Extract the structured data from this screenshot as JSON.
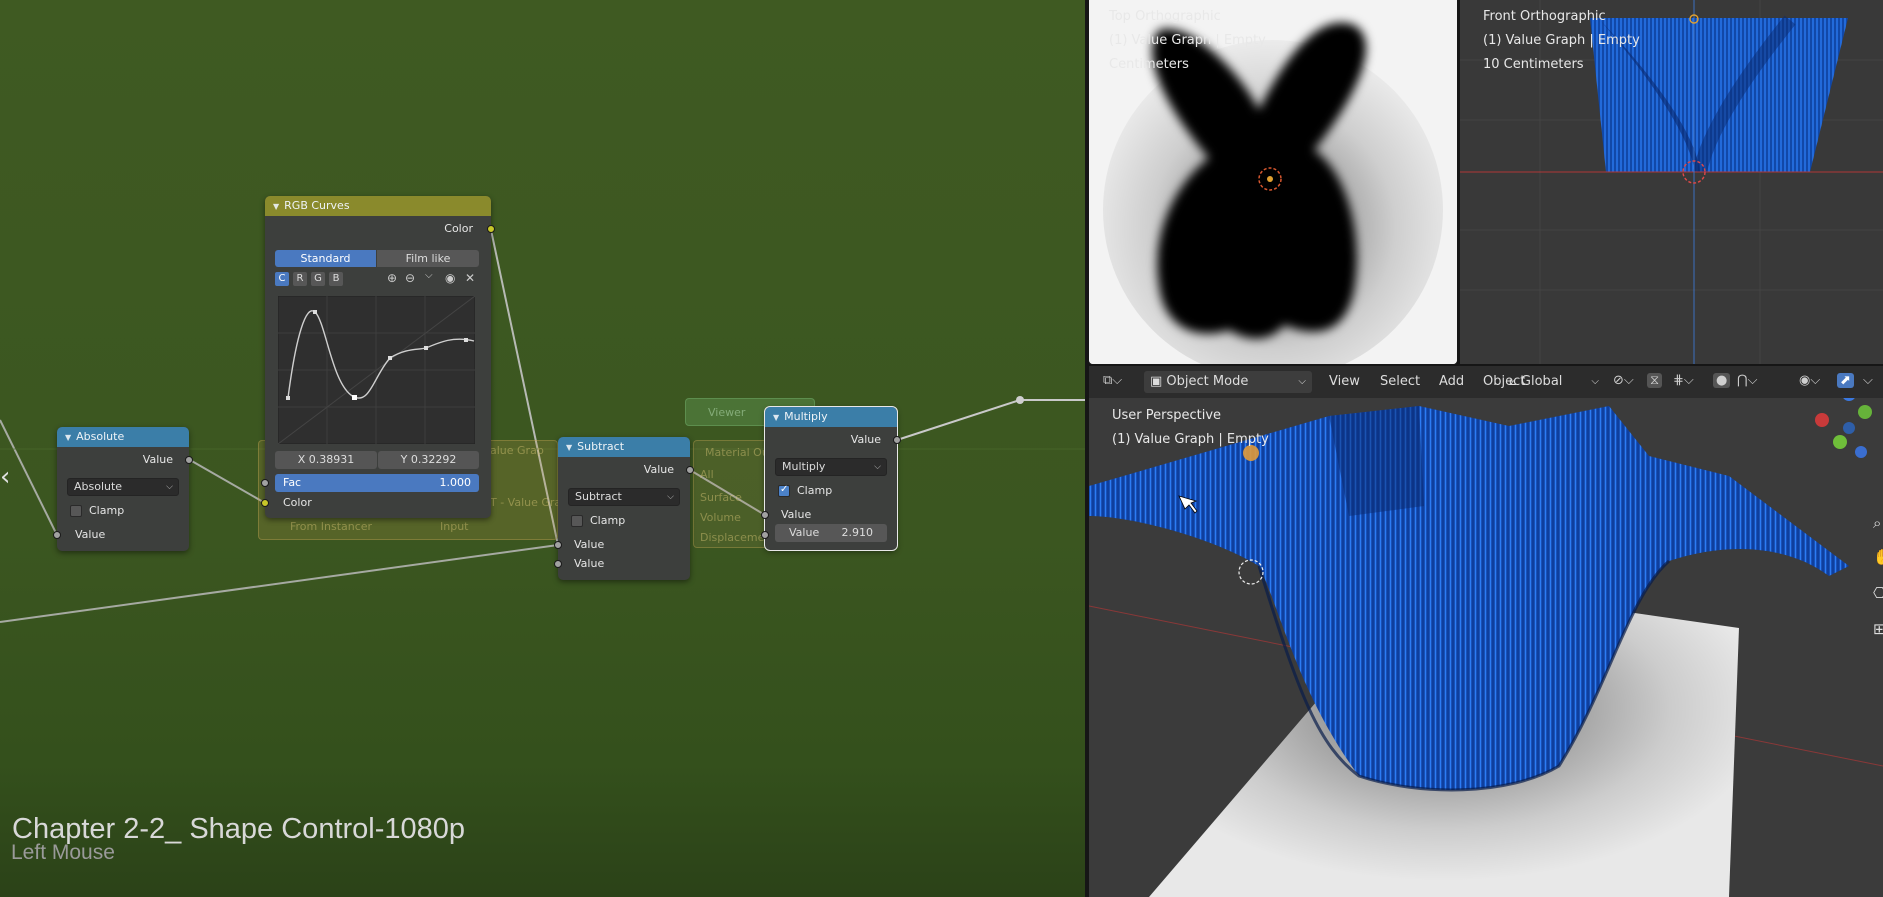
{
  "node_editor": {
    "nodes": {
      "absolute": {
        "title": "Absolute",
        "output": "Value",
        "operation": "Absolute",
        "clamp_label": "Clamp",
        "input": "Value"
      },
      "rgb_curves": {
        "title": "RGB Curves",
        "output": "Color",
        "tabs": [
          "Standard",
          "Film like"
        ],
        "channels": [
          "C",
          "R",
          "G",
          "B"
        ],
        "x_readout": "X 0.38931",
        "y_readout": "Y 0.32292",
        "fac_label": "Fac",
        "fac_value": "1.000",
        "input_color": "Color"
      },
      "subtract": {
        "title": "Subtract",
        "output": "Value",
        "operation": "Subtract",
        "clamp_label": "Clamp",
        "input1": "Value",
        "input2": "Value"
      },
      "multiply": {
        "title": "Multiply",
        "output": "Value",
        "operation": "Multiply",
        "clamp_label": "Clamp",
        "input": "Value",
        "value_label": "Value",
        "value": "2.910"
      }
    },
    "ghost_labels": {
      "value_graph": "alue Grap",
      "from_instancer": "From Instancer",
      "input": "Input",
      "viewer": "Viewer",
      "material_output": "Material Ou",
      "all": "All",
      "surface": "Surface",
      "volume": "Volume",
      "displacement": "Displacemen",
      "group_label": "T - Value Gra"
    },
    "chapter_title": "Chapter 2-2_ Shape Control-1080p",
    "key_hint": "Left Mouse"
  },
  "viewport_top": {
    "title": "Top Orthographic",
    "object": "(1) Value Graph | Empty",
    "units": "Centimeters"
  },
  "viewport_front": {
    "title": "Front Orthographic",
    "object": "(1) Value Graph | Empty",
    "units": "10 Centimeters"
  },
  "viewport_persp": {
    "title": "User Perspective",
    "object": "(1) Value Graph | Empty",
    "header": {
      "mode": "Object Mode",
      "menu": [
        "View",
        "Select",
        "Add",
        "Object"
      ],
      "orientation": "Global"
    }
  },
  "colors": {
    "node_editor_bg": "#3f5a22",
    "vector_node_header": "#3b7ea8",
    "color_node_header": "#8a8a2c",
    "point_blue": "#1e6fe0"
  }
}
